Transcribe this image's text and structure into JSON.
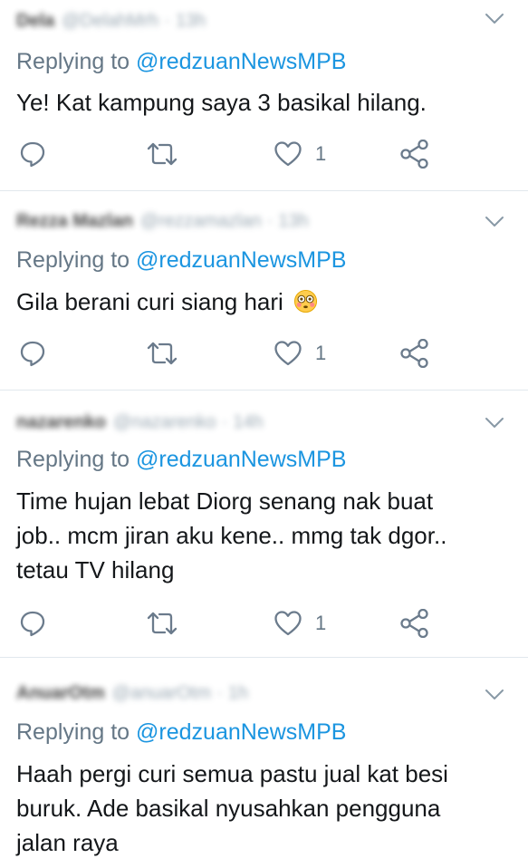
{
  "tweets": [
    {
      "name": "Dela",
      "handle": "@DelahMrh",
      "time": "13h",
      "replying_prefix": "Replying to ",
      "replying_handle": "@redzuanNewsMPB",
      "text": "Ye! Kat kampung saya 3 basikal hilang.",
      "likes": "1"
    },
    {
      "name": "Rezza Mazlan",
      "handle": "@rezzamazlan",
      "time": "13h",
      "replying_prefix": "Replying to ",
      "replying_handle": "@redzuanNewsMPB",
      "text": "Gila berani curi siang hari",
      "emoji": "flushed-face-emoji",
      "likes": "1"
    },
    {
      "name": "nazarenko",
      "handle": "@nazarenko",
      "time": "14h",
      "replying_prefix": "Replying to ",
      "replying_handle": "@redzuanNewsMPB",
      "text_lines": [
        "Time hujan lebat Diorg senang nak buat",
        "job.. mcm jiran aku kene.. mmg tak dgor..",
        "tetau TV hilang"
      ],
      "likes": "1"
    },
    {
      "name": "AnuarOtm",
      "handle": "@anuarOtm",
      "time": "1h",
      "replying_prefix": "Replying to ",
      "replying_handle": "@redzuanNewsMPB",
      "text_lines": [
        "Haah pergi curi semua pastu jual kat besi",
        "buruk. Ade basikal nyusahkan pengguna",
        "jalan raya"
      ]
    }
  ],
  "icons": {
    "reply": "reply-bubble-icon",
    "retweet": "retweet-icon",
    "like": "heart-icon",
    "share": "share-icon",
    "menu": "chevron-down-icon"
  },
  "colors": {
    "link": "#1b95e0",
    "muted": "#657786",
    "icon": "#6b7b8c",
    "text": "#14171a",
    "divider": "#e1e8ed"
  }
}
